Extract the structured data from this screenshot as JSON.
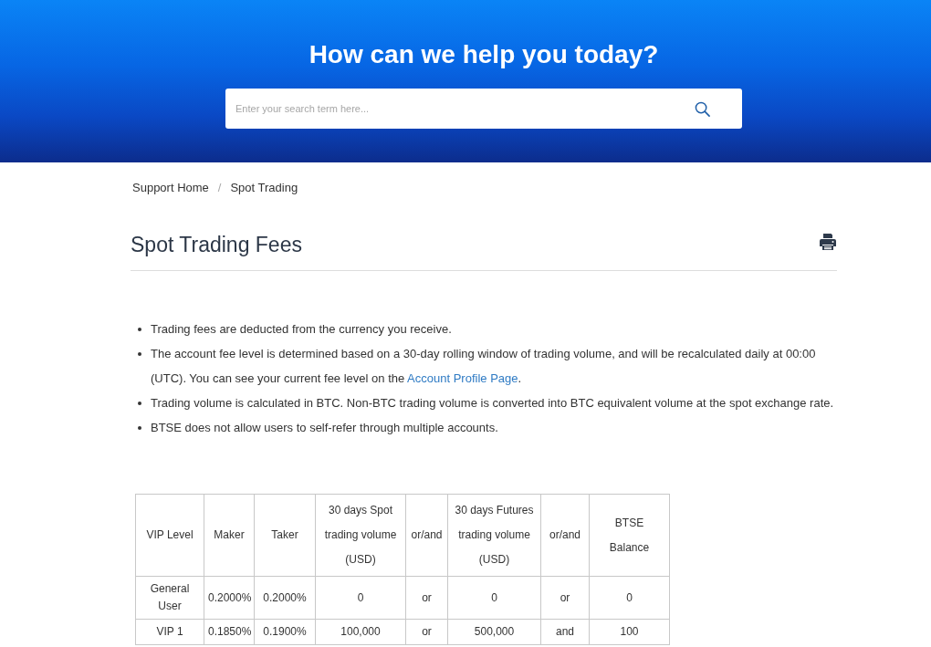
{
  "hero": {
    "title": "How can we help you today?",
    "search": {
      "placeholder": "Enter your search term here..."
    }
  },
  "breadcrumb": {
    "items": [
      {
        "label": "Support Home"
      },
      {
        "label": "Spot Trading"
      }
    ],
    "separator": "/"
  },
  "article": {
    "title": "Spot Trading Fees",
    "bullets": [
      {
        "segments": [
          {
            "kind": "text",
            "text": "Trading fees are deducted from the currency you receive."
          }
        ]
      },
      {
        "segments": [
          {
            "kind": "text",
            "text": "The account fee level is determined based on a 30-day rolling window of trading volume, and will be recalculated daily at 00:00 (UTC). You can see your current fee level on the "
          },
          {
            "kind": "link",
            "text": "Account Profile Page"
          },
          {
            "kind": "text",
            "text": "."
          }
        ]
      },
      {
        "segments": [
          {
            "kind": "text",
            "text": "Trading volume is calculated in BTC. Non-BTC trading volume is converted into BTC equivalent volume at the spot exchange rate."
          }
        ]
      },
      {
        "segments": [
          {
            "kind": "text",
            "text": "BTSE does not allow users to self-refer through multiple accounts."
          }
        ]
      }
    ],
    "table": {
      "columns": [
        "VIP Level",
        "Maker",
        "Taker",
        "30 days Spot trading volume (USD)",
        "or/and",
        "30 days Futures trading volume (USD)",
        "or/and",
        "BTSE Balance"
      ],
      "rows": [
        [
          "General User",
          "0.2000%",
          "0.2000%",
          "0",
          "or",
          "0",
          "or",
          "0"
        ],
        [
          "VIP 1",
          "0.1850%",
          "0.1900%",
          "100,000",
          "or",
          "500,000",
          "and",
          "100"
        ]
      ]
    }
  }
}
